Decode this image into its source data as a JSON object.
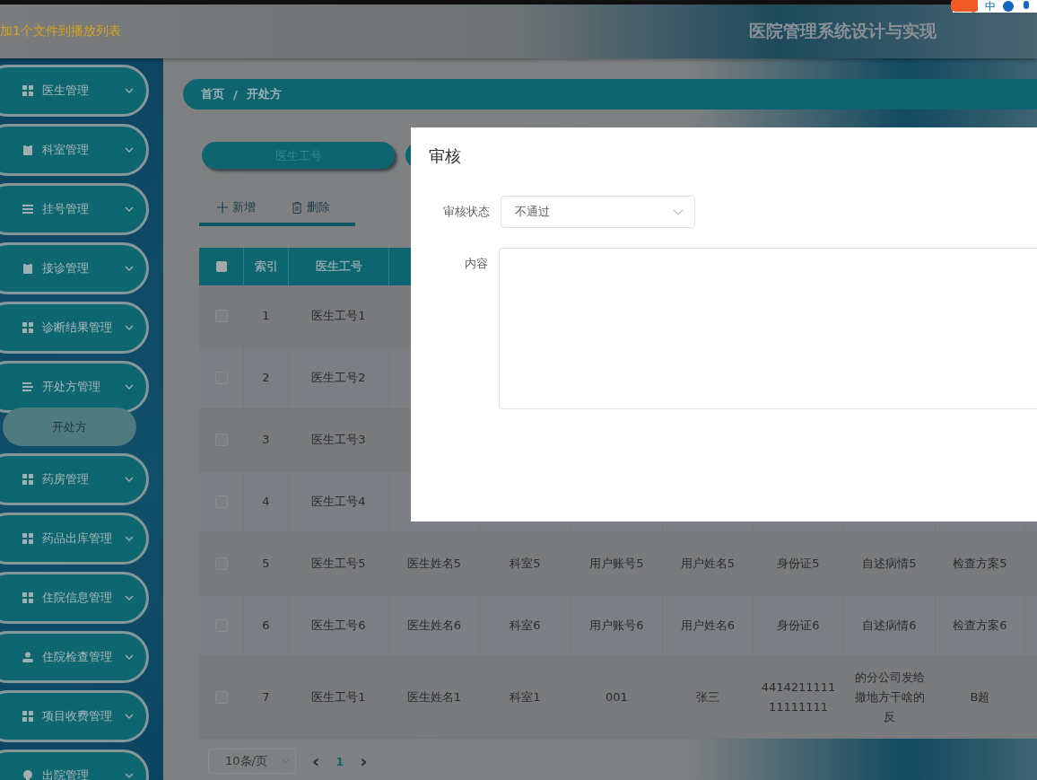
{
  "notification": "加1个文件到播放列表",
  "header": {
    "title": "医院管理系统设计与实现"
  },
  "ime_toolbar": {
    "mode": "中"
  },
  "sidebar": {
    "items": [
      {
        "label": "医生管理"
      },
      {
        "label": "科室管理"
      },
      {
        "label": "挂号管理"
      },
      {
        "label": "接诊管理"
      },
      {
        "label": "诊断结果管理"
      },
      {
        "label": "开处方管理",
        "children": [
          {
            "label": "开处方",
            "selected": true
          }
        ]
      },
      {
        "label": "药房管理"
      },
      {
        "label": "药品出库管理"
      },
      {
        "label": "住院信息管理"
      },
      {
        "label": "住院检查管理"
      },
      {
        "label": "项目收费管理"
      },
      {
        "label": "出院管理"
      }
    ]
  },
  "breadcrumb": [
    "首页",
    "/",
    "开处方"
  ],
  "search": {
    "placeholder": "医生工号"
  },
  "actions": [
    {
      "label": "新增",
      "kind": "add"
    },
    {
      "label": "删除",
      "kind": "delete"
    }
  ],
  "table": {
    "select_all": {
      "checked": false
    },
    "columns": [
      "索引",
      "医生工号"
    ],
    "rows": [
      {
        "checked": false,
        "cells": [
          "1",
          "医生工号1"
        ]
      },
      {
        "checked": false,
        "cells": [
          "2",
          "医生工号2"
        ]
      },
      {
        "checked": false,
        "cells": [
          "3",
          "医生工号3"
        ]
      },
      {
        "checked": false,
        "cells": [
          "4",
          "医生工号4"
        ]
      },
      {
        "checked": false,
        "cells": [
          "5",
          "医生工号5",
          "医生姓名5",
          "科室5",
          "用户账号5",
          "用户姓名5",
          "身份证5",
          "自述病情5",
          "检查方案5"
        ]
      },
      {
        "checked": false,
        "cells": [
          "6",
          "医生工号6",
          "医生姓名6",
          "科室6",
          "用户账号6",
          "用户姓名6",
          "身份证6",
          "自述病情6",
          "检查方案6"
        ]
      },
      {
        "checked": false,
        "cells": [
          "7",
          "医生工号1",
          "医生姓名1",
          "科室1",
          "001",
          "张三",
          "441421111111111111",
          "的分公司发给撒地方干啥的反",
          "B超"
        ]
      }
    ]
  },
  "pagination": {
    "page_size": "10条/页",
    "prev": "‹",
    "pages": [
      {
        "label": "1",
        "selected": true
      }
    ],
    "next": "›"
  },
  "dialog": {
    "title": "审核",
    "fields": [
      {
        "kind": "select",
        "label": "审核状态",
        "value": "不通过"
      },
      {
        "kind": "textarea",
        "label": "内容"
      }
    ]
  }
}
